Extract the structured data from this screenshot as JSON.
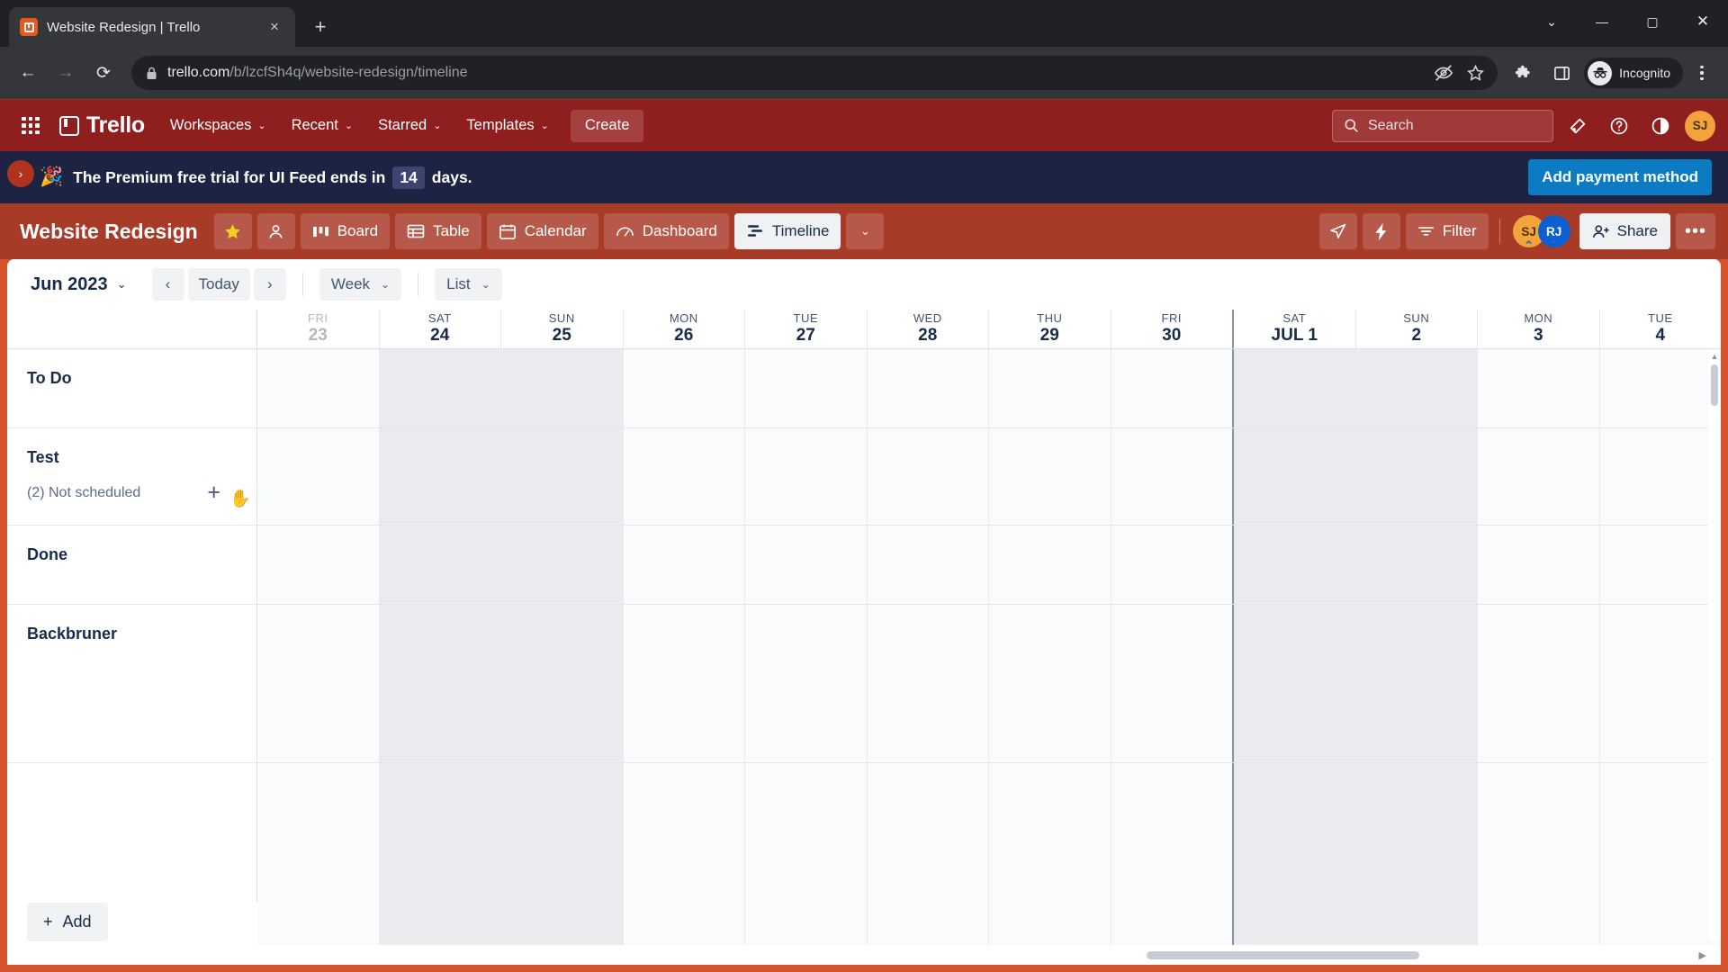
{
  "browser": {
    "tab": {
      "title": "Website Redesign | Trello",
      "favicon": "trello-icon",
      "close": "×"
    },
    "new_tab": "+",
    "window_controls": {
      "minimize_group": "⌄",
      "minimize": "—",
      "maximize": "▢",
      "close": "✕"
    },
    "nav": {
      "back": "←",
      "forward": "→",
      "reload": "⟳"
    },
    "omnibox": {
      "lock_icon": "lock-icon",
      "url_domain": "trello.com",
      "url_path": "/b/lzcfSh4q/website-redesign/timeline",
      "hide_icon": "eye-off-icon",
      "bookmark_icon": "star-icon"
    },
    "toolbar_right": {
      "extensions_icon": "puzzle-icon",
      "side_panel_icon": "side-panel-icon",
      "incognito_label": "Incognito",
      "menu_icon": "kebab-menu-icon"
    }
  },
  "trello_header": {
    "apps_icon": "app-grid-icon",
    "brand": "Trello",
    "nav_items": [
      {
        "label": "Workspaces",
        "caret": "⌄"
      },
      {
        "label": "Recent",
        "caret": "⌄"
      },
      {
        "label": "Starred",
        "caret": "⌄"
      },
      {
        "label": "Templates",
        "caret": "⌄"
      }
    ],
    "create_label": "Create",
    "search_placeholder": "Search",
    "icons": {
      "notifications": "bell-icon",
      "help": "help-icon",
      "theme": "theme-contrast-icon"
    },
    "avatar_initials": "SJ",
    "bar_color": "#8f1f1f"
  },
  "banner": {
    "side_toggle": "›",
    "emoji": "🎉",
    "text_before": "The Premium free trial for UI Feed ends in",
    "days": "14",
    "text_after": "days.",
    "cta_label": "Add payment method",
    "cta_color": "#0b7bc4",
    "bg_color": "#1d2343"
  },
  "board_header": {
    "title": "Website Redesign",
    "star_icon": "star-filled-icon",
    "visibility_icon": "workspace-visible-icon",
    "views": [
      {
        "label": "Board",
        "icon": "board-icon",
        "active": false
      },
      {
        "label": "Table",
        "icon": "table-icon",
        "active": false
      },
      {
        "label": "Calendar",
        "icon": "calendar-icon",
        "active": false
      },
      {
        "label": "Dashboard",
        "icon": "dashboard-icon",
        "active": false
      },
      {
        "label": "Timeline",
        "icon": "timeline-icon",
        "active": true
      }
    ],
    "views_caret": "⌄",
    "rocket_icon": "rocket-icon",
    "automation_icon": "lightning-bolt-icon",
    "filter_label": "Filter",
    "filter_icon": "filter-icon",
    "members": [
      {
        "initials": "SJ",
        "color": "#f2a33c"
      },
      {
        "initials": "RJ",
        "color": "#0b5fd0"
      }
    ],
    "share_label": "Share",
    "share_icon": "person-add-icon",
    "more_label": "•••",
    "bar_color": "#a83a28"
  },
  "timeline": {
    "toolbar": {
      "month_label": "Jun 2023",
      "month_caret": "⌄",
      "prev": "‹",
      "today_label": "Today",
      "next": "›",
      "unit_label": "Week",
      "unit_caret": "⌄",
      "group_label": "List",
      "group_caret": "⌄"
    },
    "days": [
      {
        "dow": "FRI",
        "num": "23",
        "past": true,
        "weekend": false,
        "month_start": false
      },
      {
        "dow": "SAT",
        "num": "24",
        "past": false,
        "weekend": true,
        "month_start": false
      },
      {
        "dow": "SUN",
        "num": "25",
        "past": false,
        "weekend": true,
        "month_start": false
      },
      {
        "dow": "MON",
        "num": "26",
        "past": false,
        "weekend": false,
        "month_start": false
      },
      {
        "dow": "TUE",
        "num": "27",
        "past": false,
        "weekend": false,
        "month_start": false
      },
      {
        "dow": "WED",
        "num": "28",
        "past": false,
        "weekend": false,
        "month_start": false
      },
      {
        "dow": "THU",
        "num": "29",
        "past": false,
        "weekend": false,
        "month_start": false
      },
      {
        "dow": "FRI",
        "num": "30",
        "past": false,
        "weekend": false,
        "month_start": false
      },
      {
        "dow": "SAT",
        "num": "JUL 1",
        "past": false,
        "weekend": true,
        "month_start": true
      },
      {
        "dow": "SUN",
        "num": "2",
        "past": false,
        "weekend": true,
        "month_start": false
      },
      {
        "dow": "MON",
        "num": "3",
        "past": false,
        "weekend": false,
        "month_start": false
      },
      {
        "dow": "TUE",
        "num": "4",
        "past": false,
        "weekend": false,
        "month_start": false
      }
    ],
    "lanes": [
      {
        "name": "To Do",
        "sub": "",
        "plus": ""
      },
      {
        "name": "Test",
        "sub": "(2) Not scheduled",
        "plus": "+"
      },
      {
        "name": "Done",
        "sub": "",
        "plus": ""
      },
      {
        "name": "Backbruner",
        "sub": "",
        "plus": ""
      }
    ],
    "add_label": "Add",
    "add_icon": "+",
    "scroll_up_arrow": "▲",
    "scroll_right_arrow": "▶"
  }
}
